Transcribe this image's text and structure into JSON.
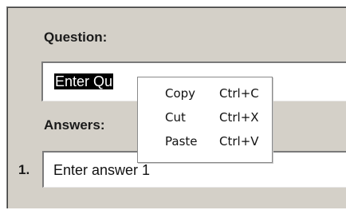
{
  "form": {
    "question_label": "Question:",
    "question_value": "Enter Qu",
    "answers_label": "Answers:",
    "answer_number": "1.",
    "answer_value": "Enter answer 1"
  },
  "context_menu": {
    "items": [
      {
        "label": "Copy",
        "shortcut": "Ctrl+C"
      },
      {
        "label": "Cut",
        "shortcut": "Ctrl+X"
      },
      {
        "label": "Paste",
        "shortcut": "Ctrl+V"
      }
    ]
  },
  "colors": {
    "panel_bg": "#d4d0c8",
    "selection_bg": "#000000",
    "selection_fg": "#ffffff",
    "menu_bg": "#ffffff"
  }
}
